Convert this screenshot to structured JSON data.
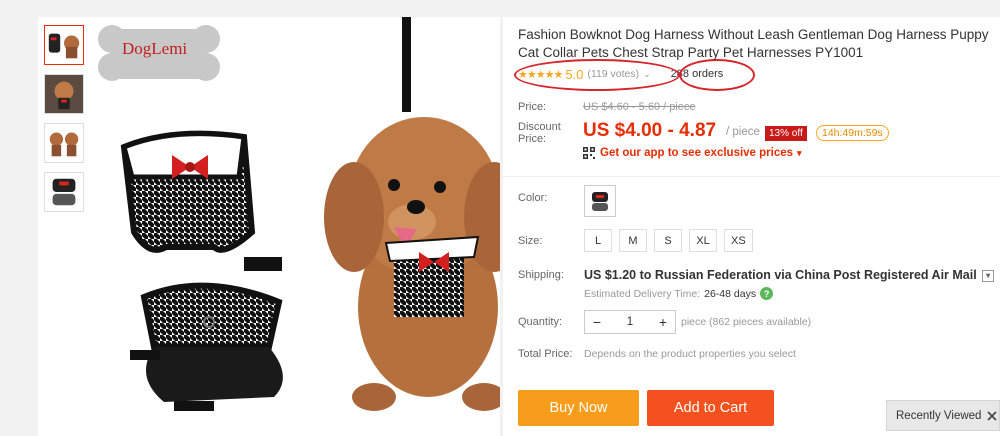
{
  "product": {
    "title": "Fashion Bowknot Dog Harness Without Leash Gentleman Dog Harness Puppy Cat Collar Pets Chest Strap Party Pet Harnesses PY1001",
    "brand_logo": "DogLemi"
  },
  "rating": {
    "stars": "★★★★★",
    "score": "5.0",
    "votes": "(119 votes)",
    "caret": "⌄",
    "orders": "288 orders"
  },
  "price": {
    "price_label": "Price:",
    "original": "US $4.60 - 5.60 / piece",
    "discount_label_1": "Discount",
    "discount_label_2": "Price:",
    "discount": "US $4.00 - 4.87",
    "unit": "/ piece",
    "off_badge": "13% off",
    "timer": "14h:49m:59s",
    "app_promo": "Get our app to see exclusive prices",
    "promo_caret": "▾"
  },
  "attributes": {
    "color_label": "Color:",
    "size_label": "Size:",
    "sizes": [
      "L",
      "M",
      "S",
      "XL",
      "XS"
    ]
  },
  "shipping": {
    "label": "Shipping:",
    "text": "US $1.20 to Russian Federation via China Post Registered Air Mail",
    "delivery_label": "Estimated Delivery Time:",
    "delivery_days": "26-48 days",
    "help": "?"
  },
  "quantity": {
    "label": "Quantity:",
    "minus": "−",
    "value": "1",
    "plus": "+",
    "note": "piece (862 pieces available)"
  },
  "total": {
    "label": "Total Price:",
    "note": "Depends on the product properties you select"
  },
  "actions": {
    "buy_now": "Buy Now",
    "add_to_cart": "Add to Cart"
  },
  "recently_viewed": "Recently Viewed",
  "colors": {
    "accent_red": "#e62e04",
    "star_orange": "#f5a623",
    "buy_orange": "#f89c1c",
    "cart_orange": "#f4511e"
  }
}
